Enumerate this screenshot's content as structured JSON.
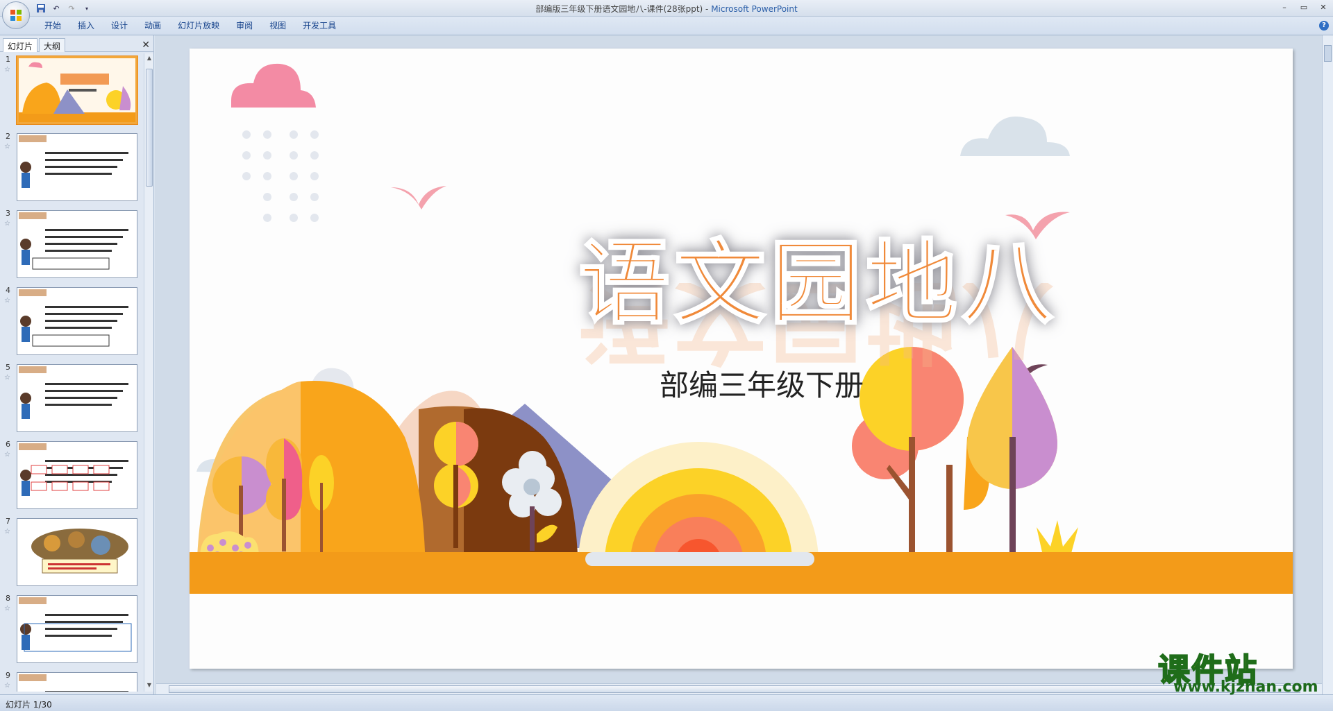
{
  "window": {
    "title": "部编版三年级下册语文园地八-课件(28张ppt)",
    "app_name": "Microsoft PowerPoint",
    "title_separator": " - "
  },
  "ribbon": {
    "tabs": [
      "开始",
      "插入",
      "设计",
      "动画",
      "幻灯片放映",
      "审阅",
      "视图",
      "开发工具"
    ]
  },
  "panel": {
    "tab_slides": "幻灯片",
    "tab_outline": "大纲",
    "thumbnails": [
      {
        "num": "1",
        "selected": true
      },
      {
        "num": "2"
      },
      {
        "num": "3"
      },
      {
        "num": "4"
      },
      {
        "num": "5"
      },
      {
        "num": "6"
      },
      {
        "num": "7"
      },
      {
        "num": "8"
      },
      {
        "num": "9"
      }
    ]
  },
  "slide": {
    "title": "语文园地八",
    "subtitle": "部编三年级下册"
  },
  "status": {
    "slide_counter": "幻灯片 1/30"
  },
  "watermark": {
    "name": "课件站",
    "url": "www.kjzhan.com"
  },
  "colors": {
    "accent_orange": "#f08a3a",
    "selection": "#f2a73b"
  }
}
